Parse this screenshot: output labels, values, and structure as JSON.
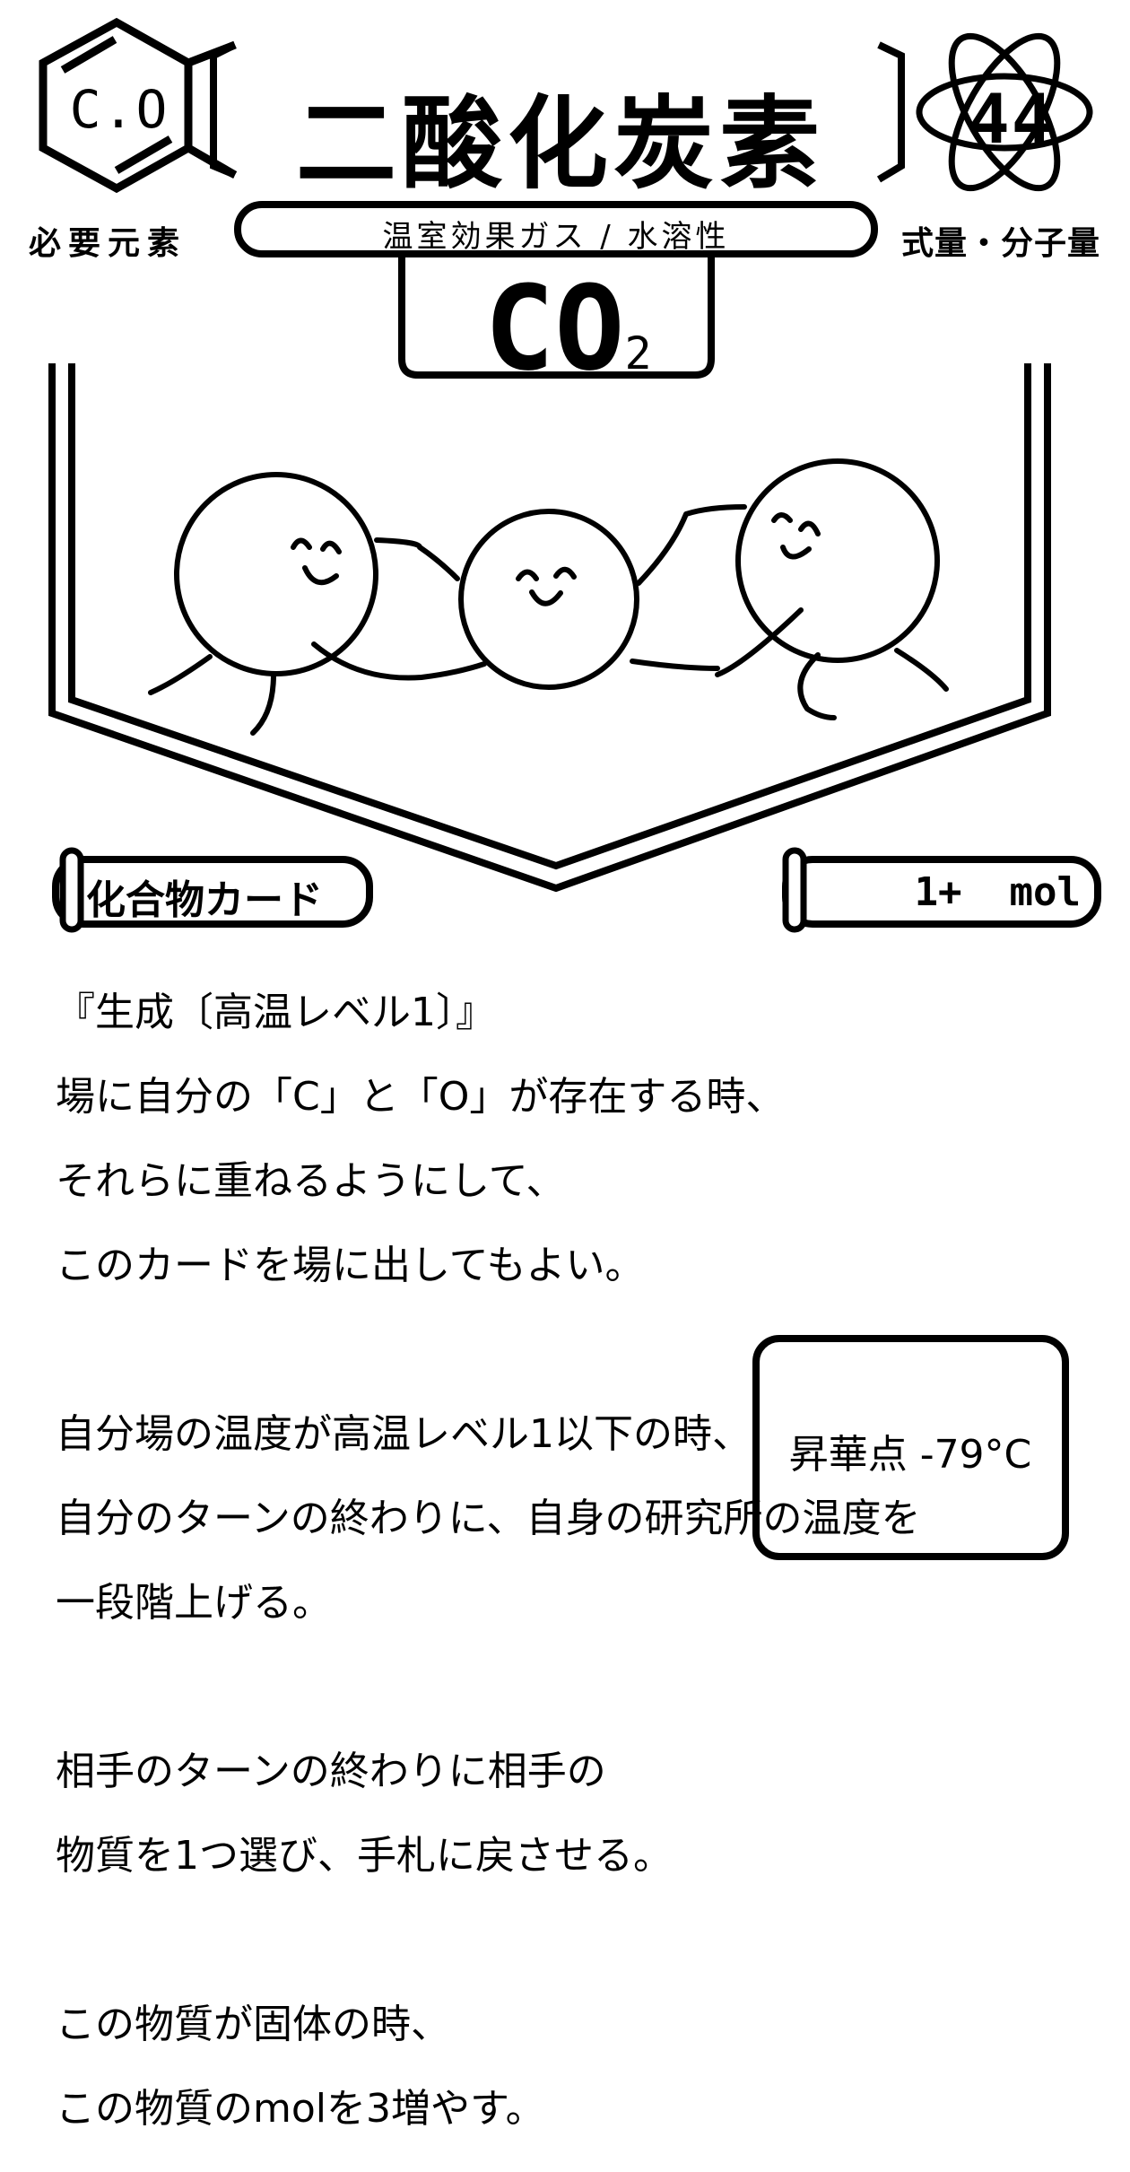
{
  "card": {
    "required_elements_symbol": "C.O",
    "required_elements_label": "必要元素",
    "name": "二酸化炭素",
    "formula_weight": "44",
    "formula_weight_label": "式量・分子量",
    "properties": "温室効果ガス / 水溶性",
    "formula_main": "CO",
    "formula_subscript": "2",
    "card_type": "化合物カード",
    "mol": "1+  mol",
    "effect_lines": [
      "『生成〔高温レベル1〕』",
      "場に自分の「C」と「O」が存在する時、",
      "それらに重ねるようにして、",
      "このカードを場に出してもよい。",
      "",
      "自分場の温度が高温レベル1以下の時、",
      "自分のターンの終わりに、自身の研究所の温度を",
      "一段階上げる。",
      "",
      "相手のターンの終わりに相手の",
      "物質を1つ選び、手札に戻させる。",
      "",
      "この物質が固体の時、",
      "この物質のmolを3増やす。"
    ],
    "sublimation_point": "昇華点 -79°C"
  },
  "icons": {
    "hexagon": "benzene-hexagon-icon",
    "atom": "atom-orbit-icon"
  },
  "colors": {
    "ink": "#000000",
    "paper": "#ffffff"
  }
}
